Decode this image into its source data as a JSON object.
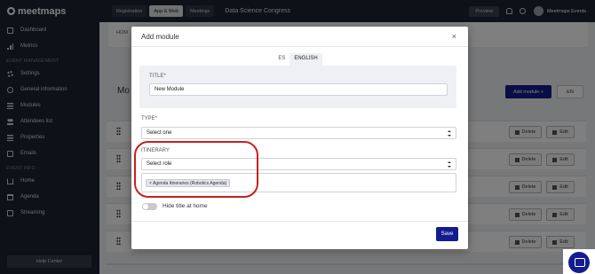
{
  "sidebar": {
    "brand": "meetmaps",
    "section_event_management": "EVENT MANAGEMENT",
    "section_event_info": "EVENT INFO",
    "items": [
      {
        "label": "Dashboard",
        "icon": "dashboard-icon"
      },
      {
        "label": "Metrics",
        "icon": "metrics-icon"
      },
      {
        "label": "Settings",
        "icon": "gear-icon"
      },
      {
        "label": "General information",
        "icon": "info-icon"
      },
      {
        "label": "Modules",
        "icon": "list-icon"
      },
      {
        "label": "Attendees list",
        "icon": "users-icon"
      },
      {
        "label": "Properties",
        "icon": "list-icon"
      },
      {
        "label": "Emails",
        "icon": "mail-icon"
      },
      {
        "label": "Home",
        "icon": "home-icon"
      },
      {
        "label": "Agenda",
        "icon": "calendar-icon"
      },
      {
        "label": "Streaming",
        "icon": "streaming-icon"
      }
    ],
    "help": "Help Center"
  },
  "topbar": {
    "tabs": [
      "Registration",
      "App & Web",
      "Meetings"
    ],
    "active_tab": "App & Web",
    "event_name": "Data Science Congress",
    "preview": "Preview",
    "org": "Meetmaps Events"
  },
  "background": {
    "breadcrumb": "HOM",
    "page_title": "Mo",
    "add_module": "Add module +",
    "lang": "EN",
    "delete": "Delete",
    "edit": "Edit"
  },
  "modal": {
    "title": "Add module",
    "close": "×",
    "langs": [
      "ES",
      "ENGLISH"
    ],
    "active_lang": "ENGLISH",
    "title_label": "TITLE*",
    "title_value": "New Module",
    "type_label": "TYPE*",
    "type_value": "Select one",
    "itinerary_label": "ITINERARY",
    "role_value": "Select role",
    "tag": "× Agenda Itineraries (Robotics Agenda)",
    "toggle_label": "Hide title at home",
    "save": "Save"
  },
  "colors": {
    "primary": "#131d8e",
    "sidebar": "#1c2230",
    "annotation": "#c8201f"
  }
}
